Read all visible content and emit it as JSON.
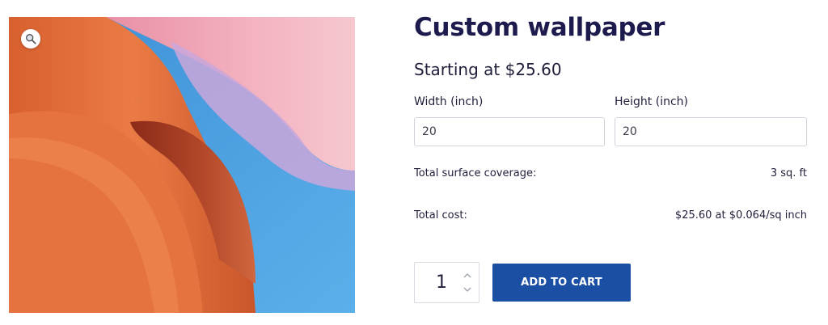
{
  "product": {
    "title": "Custom wallpaper",
    "price_text": "Starting at $25.60"
  },
  "image": {
    "zoom_icon": "magnifier-icon",
    "colors": {
      "orange": "#e2713f",
      "pink": "#f2aab8",
      "blue": "#4aa3e0",
      "lilac": "#c8a8d8"
    }
  },
  "dimensions": {
    "width_label": "Width (inch)",
    "width_value": "20",
    "height_label": "Height (inch)",
    "height_value": "20"
  },
  "summary": {
    "coverage_label": "Total surface coverage:",
    "coverage_value": "3 sq. ft",
    "cost_label": "Total cost:",
    "cost_value": "$25.60 at $0.064/sq inch"
  },
  "cart": {
    "quantity": "1",
    "add_to_cart_label": "ADD TO CART",
    "button_color": "#1a4fa3"
  }
}
